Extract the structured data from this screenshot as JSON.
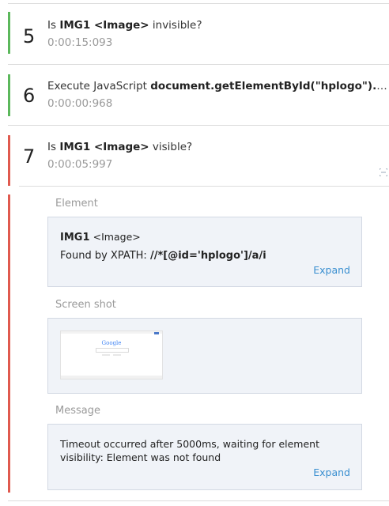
{
  "steps": [
    {
      "number": "5",
      "action": "Is",
      "target": "IMG1 <Image>",
      "suffix": " invisible?",
      "time": "0:00:15:093",
      "status": "pass"
    },
    {
      "number": "6",
      "action": "Execute JavaScript",
      "target": "document.getElementById(\"hplogo\").style.visi...",
      "suffix": "",
      "time": "0:00:00:968",
      "status": "pass"
    },
    {
      "number": "7",
      "action": "Is",
      "target": "IMG1 <Image>",
      "suffix": " visible?",
      "time": "0:00:05:997",
      "status": "fail"
    }
  ],
  "details": {
    "element": {
      "label": "Element",
      "name": "IMG1",
      "type": "<Image>",
      "found_by_label": "Found by XPATH:",
      "found_by_value": "//*[@id='hplogo']/a/i",
      "expand_label": "Expand"
    },
    "screenshot": {
      "label": "Screen shot",
      "thumb_logo": "Google"
    },
    "message": {
      "label": "Message",
      "text": "Timeout occurred after 5000ms, waiting for element visibility: Element was not found",
      "expand_label": "Expand"
    }
  },
  "colors": {
    "pass": "#5cb85c",
    "fail": "#e05a4f",
    "link": "#3a8fd0"
  },
  "icons": {
    "collapse": "collapse-icon"
  }
}
